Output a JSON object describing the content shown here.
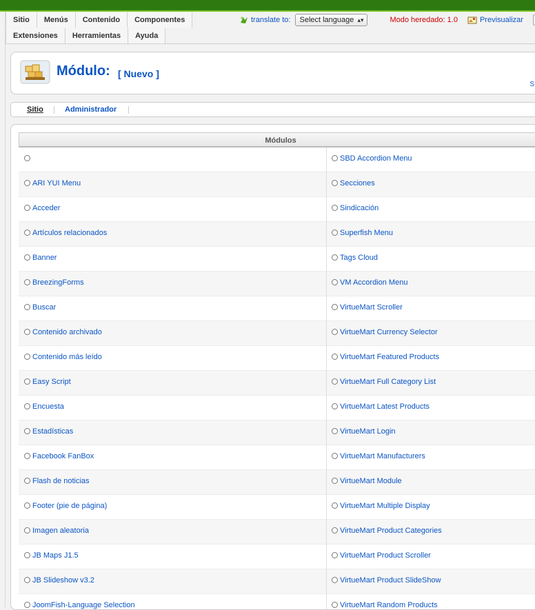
{
  "menu": {
    "row1": [
      "Sitio",
      "Menús",
      "Contenido",
      "Componentes"
    ],
    "row2": [
      "Extensiones",
      "Herramientas",
      "Ayuda"
    ]
  },
  "toolbar": {
    "translate_label": "translate to:",
    "language_select": "Select language",
    "mode_label": "Modo heredado: 1.0",
    "preview_label": "Previsualizar"
  },
  "page": {
    "title": "Módulo:",
    "subtitle": "[ Nuevo ]",
    "corner_text": "S"
  },
  "tabs": [
    "Sitio",
    "Administrador"
  ],
  "table": {
    "header": "Módulos",
    "rows": [
      [
        "",
        "SBD Accordion Menu"
      ],
      [
        "ARI YUI Menu",
        "Secciones"
      ],
      [
        "Acceder",
        "Sindicación"
      ],
      [
        "Artículos relacionados",
        "Superfish Menu"
      ],
      [
        "Banner",
        "Tags Cloud"
      ],
      [
        "BreezingForms",
        "VM Accordion Menu"
      ],
      [
        "Buscar",
        "VirtueMart Scroller"
      ],
      [
        "Contenido archivado",
        "VirtueMart Currency Selector"
      ],
      [
        "Contenido más leído",
        "VirtueMart Featured Products"
      ],
      [
        "Easy Script",
        "VirtueMart Full Category List"
      ],
      [
        "Encuesta",
        "VirtueMart Latest Products"
      ],
      [
        "Estadísticas",
        "VirtueMart Login"
      ],
      [
        "Facebook FanBox",
        "VirtueMart Manufacturers"
      ],
      [
        "Flash de noticias",
        "VirtueMart Module"
      ],
      [
        "Footer (pie de página)",
        "VirtueMart Multiple Display"
      ],
      [
        "Imagen aleatoria",
        "VirtueMart Product Categories"
      ],
      [
        "JB Maps J1.5",
        "VirtueMart Product Scroller"
      ],
      [
        "JB Slideshow v3.2",
        "VirtueMart Product SlideShow"
      ],
      [
        "JoomFish-Language Selection",
        "VirtueMart Random Products"
      ]
    ]
  },
  "colors": {
    "topbar": "#2f7a10",
    "accent": "#78c427",
    "link": "#0b55c4",
    "warning": "#c00000"
  },
  "icons": {
    "translate": "translate-icon",
    "preview": "preview-icon",
    "module": "module-icon"
  }
}
